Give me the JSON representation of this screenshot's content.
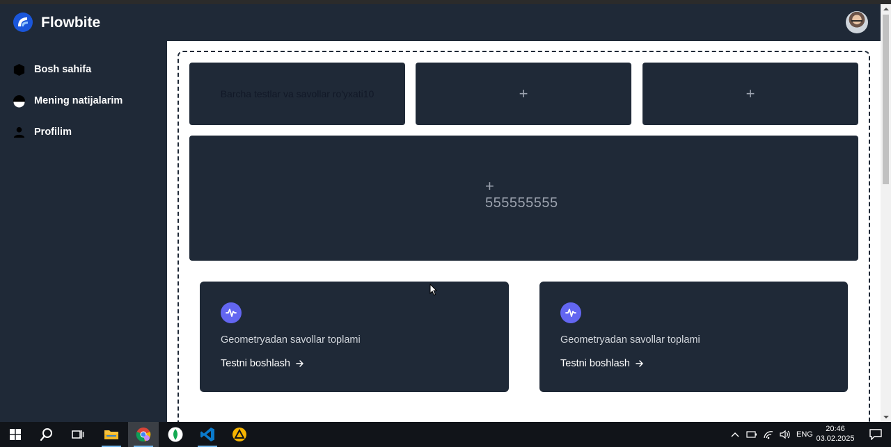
{
  "app": {
    "brand": "Flowbite"
  },
  "sidebar": {
    "items": [
      {
        "label": "Bosh sahifa"
      },
      {
        "label": "Mening natijalarim"
      },
      {
        "label": "Profilim"
      }
    ]
  },
  "tiles": {
    "first_label": "Barcha testlar va savollar ro'yxati10",
    "plus_symbol": "+",
    "big_value": "555555555"
  },
  "cards": [
    {
      "title": "Geometryadan savollar toplami",
      "link": "Testni boshlash"
    },
    {
      "title": "Geometryadan savollar toplami",
      "link": "Testni boshlash"
    }
  ],
  "taskbar": {
    "language": "ENG",
    "time": "20:46",
    "date": "03.02.2025"
  },
  "colors": {
    "sidebar_bg": "#1f2937",
    "tile_bg": "#1f2937",
    "card_icon_accent": "#6366f1",
    "logo_blue": "#1a56db",
    "taskbar_bg": "#111419"
  },
  "icons": [
    "flowbite-logo-icon",
    "home-icon",
    "results-icon",
    "user-icon",
    "chart-activity-icon",
    "arrow-right-icon"
  ]
}
